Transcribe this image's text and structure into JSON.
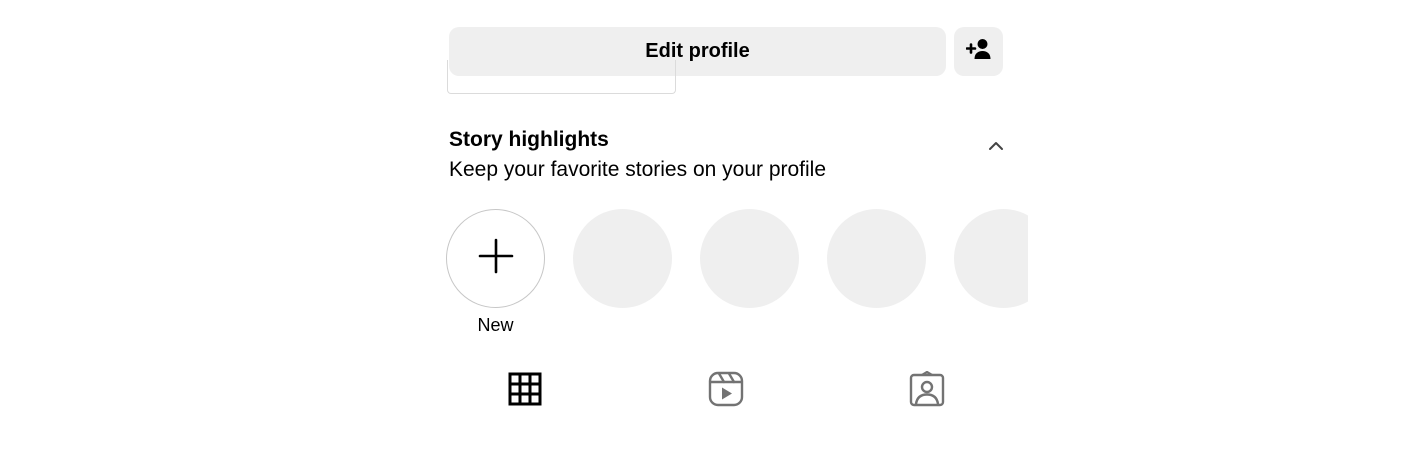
{
  "profile_actions": {
    "edit_profile_label": "Edit profile",
    "add_person_icon": "person-add-icon"
  },
  "story_highlights": {
    "title": "Story highlights",
    "subtitle": "Keep your favorite stories on your profile",
    "collapse_icon": "chevron-up-icon",
    "new_label": "New",
    "new_icon": "plus-icon",
    "placeholder_count": 4,
    "placeholder_color": "#efefef"
  },
  "tabs": [
    {
      "name": "posts",
      "icon": "grid-icon",
      "selected": true
    },
    {
      "name": "reels",
      "icon": "reels-icon",
      "selected": false
    },
    {
      "name": "tagged",
      "icon": "tagged-icon",
      "selected": false
    }
  ],
  "colors": {
    "button_bg": "#efefef",
    "text": "#000000",
    "icon_inactive": "#737373",
    "border": "#dbdbdb"
  }
}
